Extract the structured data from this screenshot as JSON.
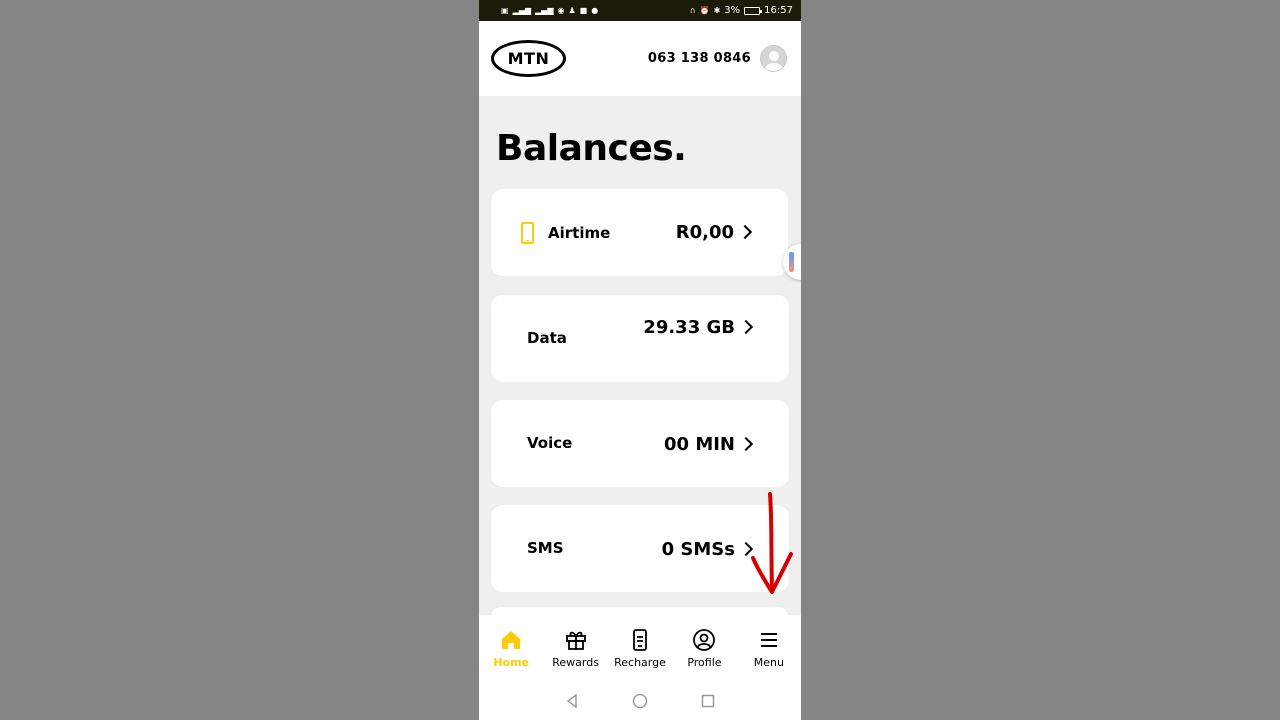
{
  "status_bar": {
    "left_icons": [
      "sim-icon",
      "signal-icon",
      "signal-icon",
      "wifi-icon",
      "notification-icon",
      "video-icon",
      "chat-icon"
    ],
    "battery": "3%",
    "time": "16:57"
  },
  "header": {
    "logo": "MTN",
    "phone_number": "063 138 0846"
  },
  "page": {
    "title": "Balances."
  },
  "balances": [
    {
      "label": "Airtime",
      "value": "R0,00",
      "icon": "phone-outline-icon"
    },
    {
      "label": "Data",
      "value": "29.33 GB"
    },
    {
      "label": "Voice",
      "value": "00 MIN"
    },
    {
      "label": "SMS",
      "value": "0 SMSs"
    }
  ],
  "bottom_nav": [
    {
      "label": "Home",
      "icon": "home-icon",
      "active": true
    },
    {
      "label": "Rewards",
      "icon": "gift-icon",
      "active": false
    },
    {
      "label": "Recharge",
      "icon": "recharge-phone-icon",
      "active": false
    },
    {
      "label": "Profile",
      "icon": "profile-icon",
      "active": false
    },
    {
      "label": "Menu",
      "icon": "hamburger-menu-icon",
      "active": false
    }
  ],
  "colors": {
    "accent": "#ffcb05",
    "annotation": "#d40000",
    "background": "#efefef"
  }
}
